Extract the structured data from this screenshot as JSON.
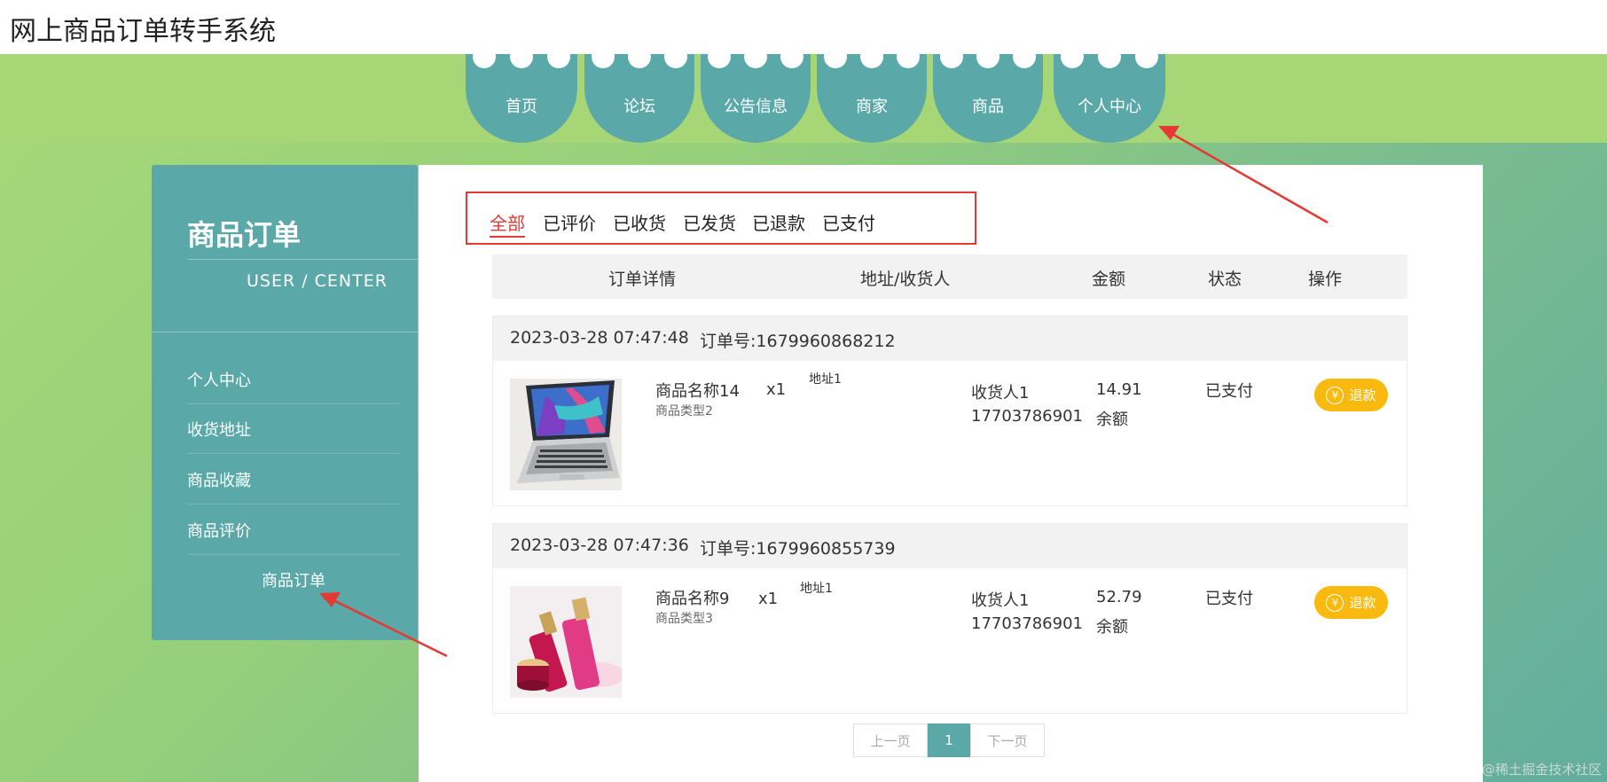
{
  "site_title": "网上商品订单转手系统",
  "nav": [
    {
      "label": "首页"
    },
    {
      "label": "论坛"
    },
    {
      "label": "公告信息"
    },
    {
      "label": "商家"
    },
    {
      "label": "商品"
    },
    {
      "label": "个人中心"
    }
  ],
  "sidebar": {
    "title": "商品订单",
    "subtitle": "USER / CENTER",
    "items": [
      {
        "label": "个人中心"
      },
      {
        "label": "收货地址"
      },
      {
        "label": "商品收藏"
      },
      {
        "label": "商品评价"
      },
      {
        "label": "商品订单"
      }
    ]
  },
  "filter_tabs": [
    {
      "label": "全部"
    },
    {
      "label": "已评价"
    },
    {
      "label": "已收货"
    },
    {
      "label": "已发货"
    },
    {
      "label": "已退款"
    },
    {
      "label": "已支付"
    }
  ],
  "table_headers": {
    "detail": "订单详情",
    "address": "地址/收货人",
    "amount": "金额",
    "status": "状态",
    "action": "操作"
  },
  "orders": [
    {
      "datetime": "2023-03-28 07:47:48",
      "order_no": "订单号:1679960868212",
      "product_name": "商品名称14",
      "product_type": "商品类型2",
      "quantity": "x1",
      "address": "地址1",
      "receiver": "收货人1",
      "phone": "17703786901",
      "price": "14.91",
      "pay_method": "余额",
      "status": "已支付",
      "action_label": "退款"
    },
    {
      "datetime": "2023-03-28 07:47:36",
      "order_no": "订单号:1679960855739",
      "product_name": "商品名称9",
      "product_type": "商品类型3",
      "quantity": "x1",
      "address": "地址1",
      "receiver": "收货人1",
      "phone": "17703786901",
      "price": "52.79",
      "pay_method": "余额",
      "status": "已支付",
      "action_label": "退款"
    }
  ],
  "pagination": {
    "prev": "上一页",
    "current": "1",
    "next": "下一页"
  },
  "watermark": "@稀土掘金技术社区",
  "colors": {
    "primary": "#5aa8a8",
    "highlight": "#e53935",
    "refund": "#f9b90e"
  }
}
